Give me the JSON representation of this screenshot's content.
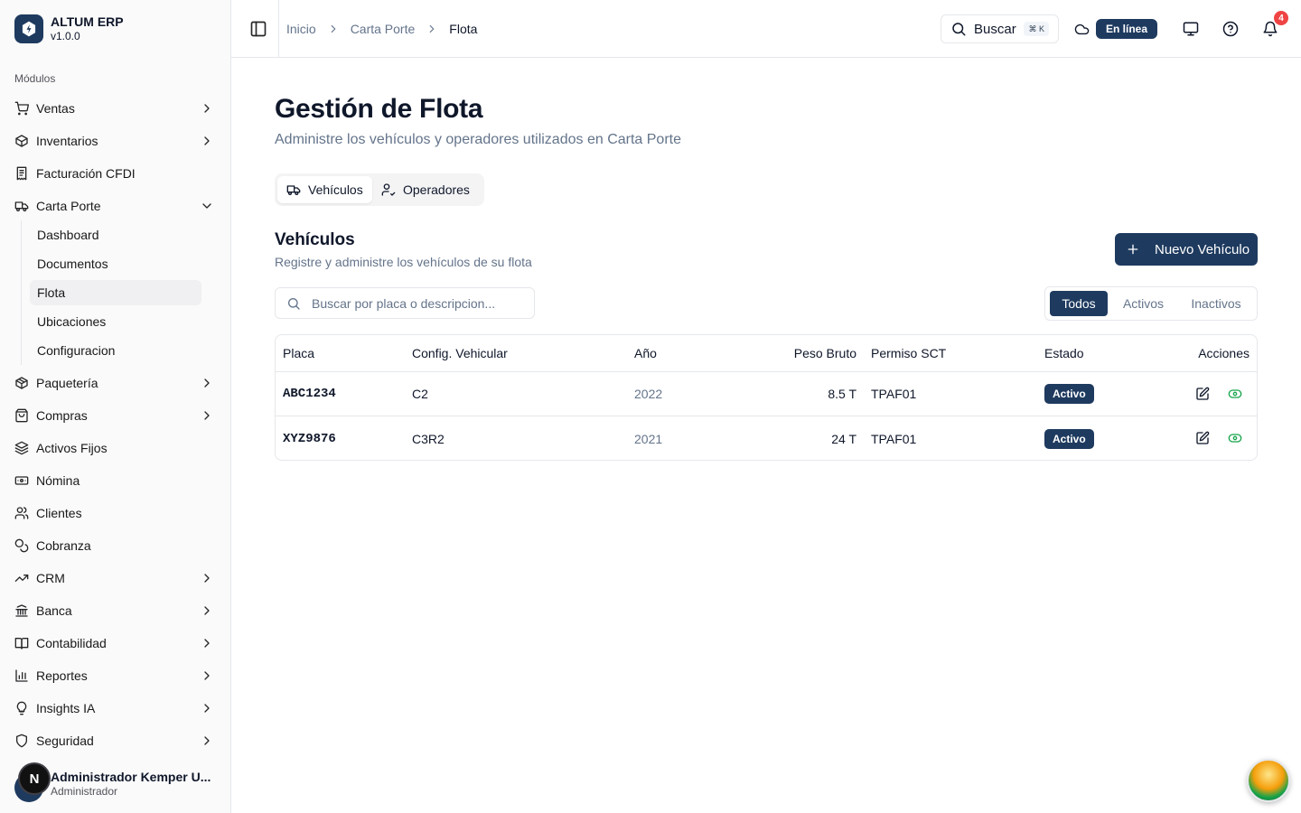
{
  "brand": {
    "name": "ALTUM ERP",
    "version": "v1.0.0"
  },
  "sidebar": {
    "section_label": "Módulos",
    "items": [
      {
        "label": "Ventas",
        "icon": "cart-icon",
        "chevron": "right"
      },
      {
        "label": "Inventarios",
        "icon": "package-icon",
        "chevron": "right"
      },
      {
        "label": "Facturación CFDI",
        "icon": "receipt-icon",
        "chevron": ""
      },
      {
        "label": "Carta Porte",
        "icon": "truck-icon",
        "chevron": "down"
      },
      {
        "label": "Paquetería",
        "icon": "box-icon",
        "chevron": "right"
      },
      {
        "label": "Compras",
        "icon": "shopping-bag-icon",
        "chevron": "right"
      },
      {
        "label": "Activos Fijos",
        "icon": "layers-icon",
        "chevron": ""
      },
      {
        "label": "Nómina",
        "icon": "banknote-icon",
        "chevron": ""
      },
      {
        "label": "Clientes",
        "icon": "users-icon",
        "chevron": ""
      },
      {
        "label": "Cobranza",
        "icon": "coins-icon",
        "chevron": ""
      },
      {
        "label": "CRM",
        "icon": "trending-up-icon",
        "chevron": "right"
      },
      {
        "label": "Banca",
        "icon": "bank-icon",
        "chevron": "right"
      },
      {
        "label": "Contabilidad",
        "icon": "book-icon",
        "chevron": "right"
      },
      {
        "label": "Reportes",
        "icon": "bar-chart-icon",
        "chevron": "right"
      },
      {
        "label": "Insights IA",
        "icon": "lightbulb-icon",
        "chevron": "right"
      },
      {
        "label": "Seguridad",
        "icon": "shield-icon",
        "chevron": "right"
      }
    ],
    "carta_porte_sub": [
      {
        "label": "Dashboard",
        "active": false
      },
      {
        "label": "Documentos",
        "active": false
      },
      {
        "label": "Flota",
        "active": true
      },
      {
        "label": "Ubicaciones",
        "active": false
      },
      {
        "label": "Configuracion",
        "active": false
      }
    ]
  },
  "user": {
    "initial": "N",
    "name": "Administrador Kemper U...",
    "role": "Administrador"
  },
  "header": {
    "breadcrumb": [
      "Inicio",
      "Carta Porte",
      "Flota"
    ],
    "search_label": "Buscar",
    "search_shortcut": "⌘ K",
    "status": "En línea",
    "notification_count": "4"
  },
  "page": {
    "title": "Gestión de Flota",
    "subtitle": "Administre los vehículos y operadores utilizados en Carta Porte",
    "tabs": [
      {
        "label": "Vehículos",
        "icon": "truck-icon",
        "active": true
      },
      {
        "label": "Operadores",
        "icon": "user-check-icon",
        "active": false
      }
    ]
  },
  "vehicles": {
    "title": "Vehículos",
    "subtitle": "Registre y administre los vehículos de su flota",
    "new_button": "Nuevo Vehículo",
    "search_placeholder": "Buscar por placa o descripcion...",
    "filters": [
      {
        "label": "Todos",
        "active": true
      },
      {
        "label": "Activos",
        "active": false
      },
      {
        "label": "Inactivos",
        "active": false
      }
    ],
    "columns": [
      "Placa",
      "Config. Vehicular",
      "Año",
      "Peso Bruto",
      "Permiso SCT",
      "Estado",
      "Acciones"
    ],
    "rows": [
      {
        "placa": "ABC1234",
        "config": "C2",
        "anio": "2022",
        "peso": "8.5 T",
        "permiso": "TPAF01",
        "estado": "Activo"
      },
      {
        "placa": "XYZ9876",
        "config": "C3R2",
        "anio": "2021",
        "peso": "24 T",
        "permiso": "TPAF01",
        "estado": "Activo"
      }
    ]
  },
  "colors": {
    "primary": "#1e3a5f",
    "danger": "#ef4444",
    "success": "#16a34a",
    "muted": "#64748b"
  }
}
